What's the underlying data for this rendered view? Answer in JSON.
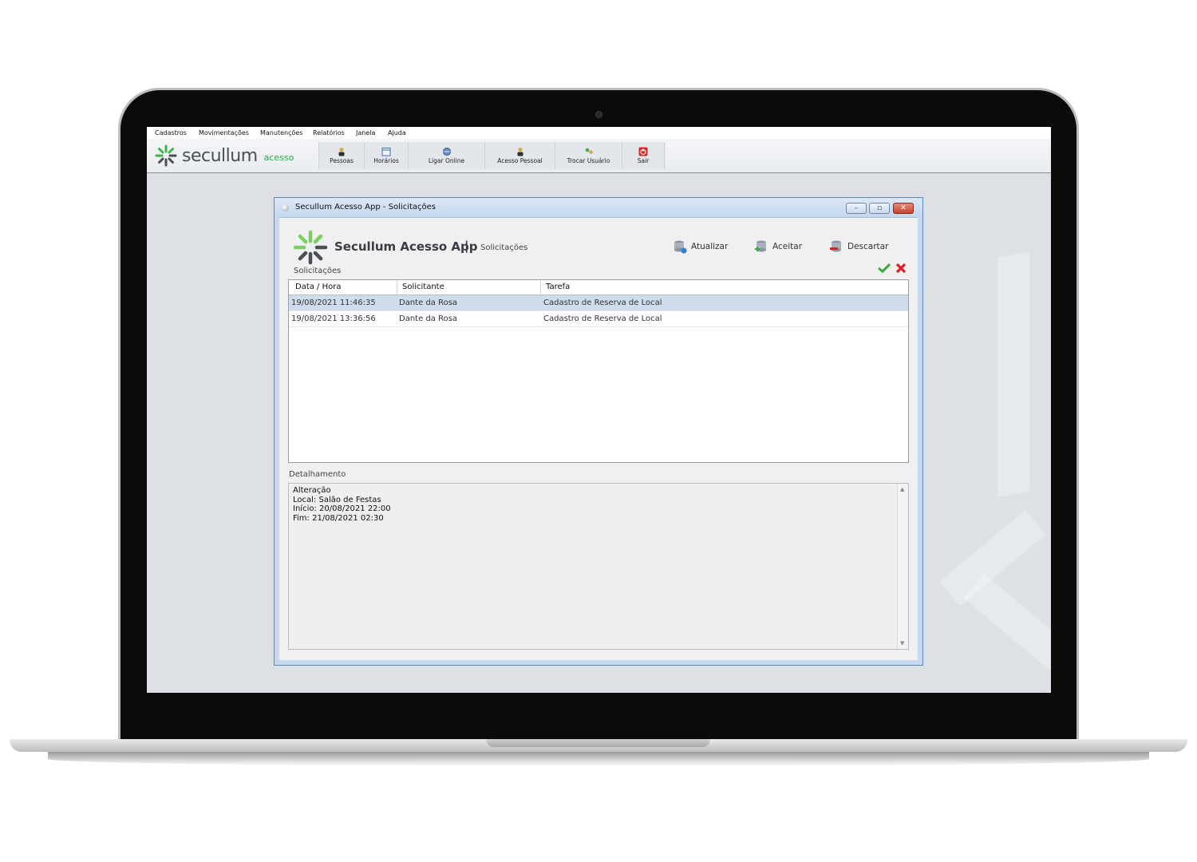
{
  "menu": {
    "items": [
      "Cadastros",
      "Movimentações",
      "Manutenções",
      "Relatórios",
      "Janela",
      "Ajuda"
    ]
  },
  "brand": {
    "word": "secullum",
    "sub": "acesso"
  },
  "toolbar": {
    "pessoas": "Pessoas",
    "horarios": "Horários",
    "ligar_online": "Ligar Online",
    "acesso_pessoal": "Acesso Pessoal",
    "trocar_usuario": "Trocar Usuário",
    "sair": "Sair"
  },
  "window": {
    "title": "Secullum Acesso App - Solicitações",
    "app_title": "Secullum Acesso App",
    "separator": "|",
    "subtitle": "Solicitações",
    "actions": {
      "atualizar": "Atualizar",
      "aceitar": "Aceitar",
      "descartar": "Descartar"
    },
    "list_label": "Solicitações",
    "columns": [
      "Data / Hora",
      "Solicitante",
      "Tarefa"
    ],
    "rows": [
      [
        "19/08/2021 11:46:35",
        "Dante da Rosa",
        "Cadastro de Reserva de Local"
      ],
      [
        "19/08/2021 13:36:56",
        "Dante da Rosa",
        "Cadastro de Reserva de Local"
      ]
    ],
    "detail_label": "Detalhamento",
    "detail_lines": [
      "Alteração",
      "Local: Salão de Festas",
      "Início: 20/08/2021 22:00",
      "Fim: 21/08/2021 02:30"
    ]
  },
  "colors": {
    "accent_green": "#2aa84a",
    "selection": "#cfdcec",
    "close_red": "#c4412b"
  }
}
